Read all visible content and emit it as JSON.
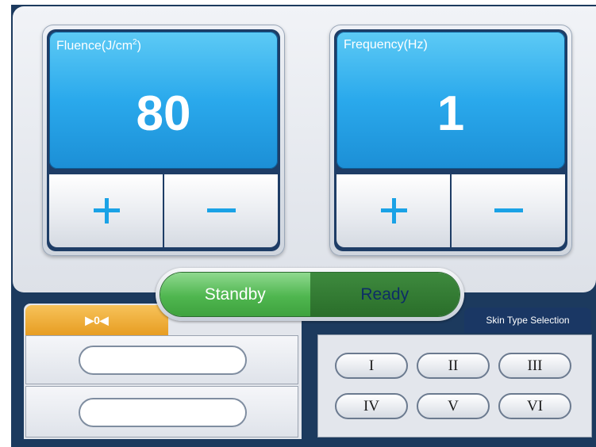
{
  "fluence": {
    "label": "Fluence(J/cm",
    "label_sup": "2",
    "label_suffix": ")",
    "value": "80"
  },
  "frequency": {
    "label": "Frequency(Hz)",
    "value": "1"
  },
  "mode": {
    "standby": "Standby",
    "ready": "Ready"
  },
  "tab": {
    "label": "▶0◀"
  },
  "skin": {
    "title": "Skin Type Selection",
    "types": [
      "I",
      "II",
      "III",
      "IV",
      "V",
      "VI"
    ]
  },
  "colors": {
    "display": "#2aa9ec",
    "accent_plus": "#1aa2e6",
    "standby": "#4fb64f",
    "tab": "#e79d22"
  }
}
